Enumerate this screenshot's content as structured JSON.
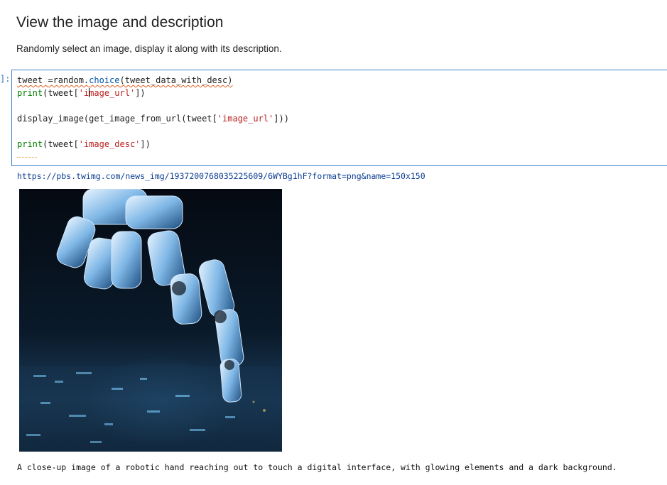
{
  "markdown": {
    "heading": "View the image and description",
    "text": "Randomly select an image, display it along with its description."
  },
  "cell": {
    "prompt": "]:",
    "code": {
      "l1_var": "tweet ",
      "l1_eq": "=random.",
      "l1_fn": "choice",
      "l1_arg": "(tweet_data_with_desc)",
      "l2_kw": "print",
      "l2_open": "(tweet[",
      "l2_str_a": "'i",
      "l2_str_b": "mage_url'",
      "l2_close": "])",
      "l3": "display_image(get_image_from_url(tweet[",
      "l3_str": "'image_url'",
      "l3_close": "]))",
      "l4_kw": "print",
      "l4_open": "(tweet[",
      "l4_str": "'image_desc'",
      "l4_close": "])"
    }
  },
  "output": {
    "url": "https://pbs.twimg.com/news_img/1937200768035225609/6WYBg1hF?format=png&name=150x150",
    "image_icon": "robotic-hand-image",
    "description": "A close-up image of a robotic hand reaching out to touch a digital interface, with glowing elements and a dark background."
  }
}
